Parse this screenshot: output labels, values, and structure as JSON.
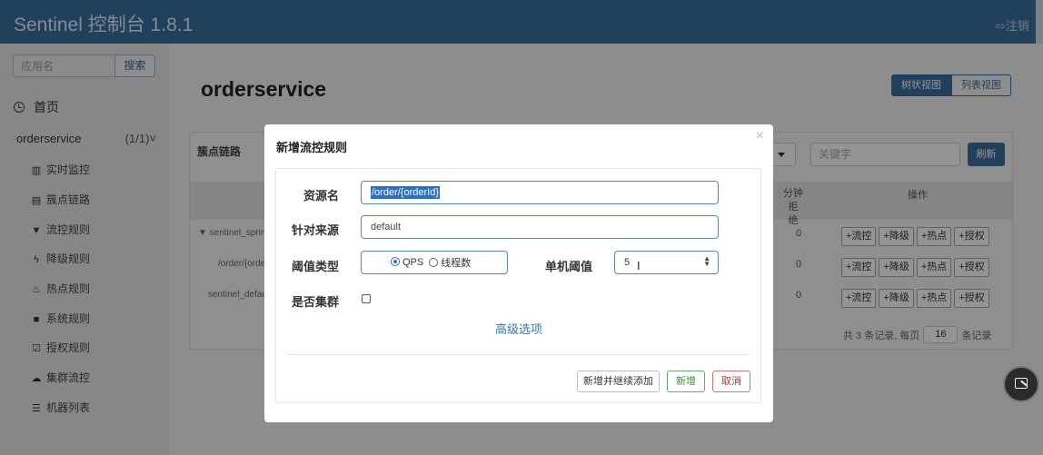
{
  "header": {
    "title": "Sentinel 控制台 1.8.1",
    "logout_label": "注销"
  },
  "sidebar": {
    "search_placeholder": "应用名",
    "search_button": "搜索",
    "home_label": "首页",
    "app_name": "orderservice",
    "app_count": "(1/1)",
    "items": [
      {
        "label": "实时监控",
        "icon": "bar-chart-icon"
      },
      {
        "label": "簇点链路",
        "icon": "list-icon"
      },
      {
        "label": "流控规则",
        "icon": "filter-icon"
      },
      {
        "label": "降级规则",
        "icon": "flash-icon"
      },
      {
        "label": "热点规则",
        "icon": "fire-icon"
      },
      {
        "label": "系统规则",
        "icon": "lock-icon"
      },
      {
        "label": "授权规则",
        "icon": "check-icon"
      },
      {
        "label": "集群流控",
        "icon": "cloud-icon"
      },
      {
        "label": "机器列表",
        "icon": "th-list-icon"
      }
    ]
  },
  "main": {
    "title": "orderservice",
    "view_tree": "树状视图",
    "view_list": "列表视图",
    "panel_title": "簇点链路",
    "keyword_placeholder": "关键字",
    "refresh_button": "刷新",
    "columns": {
      "rejected": "分钟拒\n绝",
      "ops": "操作"
    },
    "rows": [
      {
        "resource": "▼ sentinel_sprin",
        "rejected": "0"
      },
      {
        "resource": "/order/{orde",
        "rejected": "0"
      },
      {
        "resource": "sentinel_defau",
        "rejected": "0"
      }
    ],
    "ops": [
      "+流控",
      "+降级",
      "+热点",
      "+授权"
    ],
    "pager": {
      "prefix": "共 3 条记录, 每页",
      "page_size": "16",
      "suffix": "条记录"
    }
  },
  "modal": {
    "title": "新增流控规则",
    "close": "×",
    "resource_label": "资源名",
    "resource_value": "/order/{orderId}",
    "origin_label": "针对来源",
    "origin_value": "default",
    "threshold_type_label": "阈值类型",
    "qps_label": "QPS",
    "threads_label": "线程数",
    "single_threshold_label": "单机阈值",
    "single_threshold_value": "5",
    "cluster_label": "是否集群",
    "advanced_link": "高级选项",
    "btn_add_continue": "新增并继续添加",
    "btn_add": "新增",
    "btn_cancel": "取消"
  }
}
